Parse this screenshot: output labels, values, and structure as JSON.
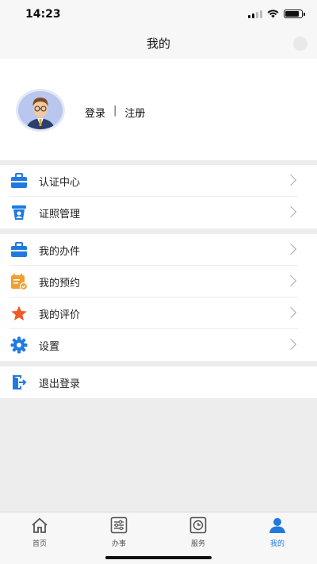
{
  "status": {
    "time": "14:23",
    "battery_level": 0.85
  },
  "header": {
    "title": "我的"
  },
  "profile": {
    "login": "登录",
    "separator": "|",
    "register": "注册"
  },
  "groups": [
    [
      {
        "label": "认证中心",
        "icon": "briefcase-icon",
        "color": "#1f7ae0"
      },
      {
        "label": "证照管理",
        "icon": "id-stand-icon",
        "color": "#1f7ae0"
      }
    ],
    [
      {
        "label": "我的办件",
        "icon": "briefcase-icon",
        "color": "#1f7ae0"
      },
      {
        "label": "我的预约",
        "icon": "calendar-check-icon",
        "color": "#f0a030"
      },
      {
        "label": "我的评价",
        "icon": "star-icon",
        "color": "#f05a28"
      },
      {
        "label": "设置",
        "icon": "gear-icon",
        "color": "#1f7ae0"
      }
    ],
    [
      {
        "label": "退出登录",
        "icon": "logout-icon",
        "color": "#1f7ae0"
      }
    ]
  ],
  "tabs": [
    {
      "label": "首页",
      "icon": "home-icon",
      "active": false
    },
    {
      "label": "办事",
      "icon": "sliders-icon",
      "active": false
    },
    {
      "label": "服务",
      "icon": "clock-icon",
      "active": false
    },
    {
      "label": "我的",
      "icon": "user-icon",
      "active": true
    }
  ],
  "colors": {
    "accent": "#1f7ae0",
    "inactive": "#555555"
  }
}
